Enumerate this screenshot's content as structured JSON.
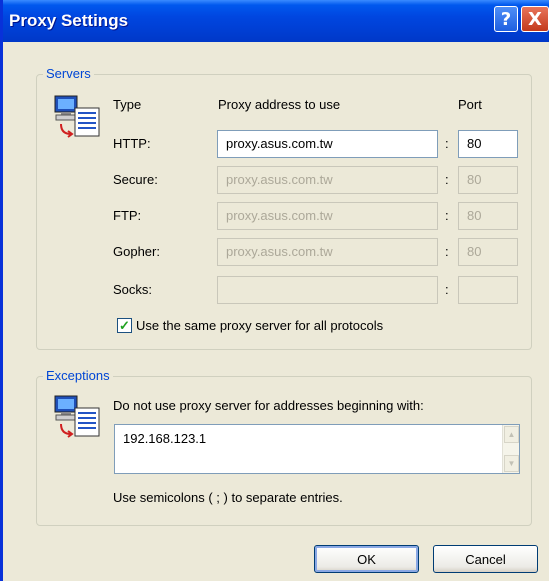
{
  "window": {
    "title": "Proxy Settings"
  },
  "servers": {
    "legend": "Servers",
    "headers": {
      "type": "Type",
      "address": "Proxy address to use",
      "port": "Port"
    },
    "rows": [
      {
        "type": "HTTP:",
        "address": "proxy.asus.com.tw",
        "port": "80",
        "enabled": true
      },
      {
        "type": "Secure:",
        "address": "proxy.asus.com.tw",
        "port": "80",
        "enabled": false
      },
      {
        "type": "FTP:",
        "address": "proxy.asus.com.tw",
        "port": "80",
        "enabled": false
      },
      {
        "type": "Gopher:",
        "address": "proxy.asus.com.tw",
        "port": "80",
        "enabled": false
      },
      {
        "type": "Socks:",
        "address": "",
        "port": "",
        "enabled": false
      }
    ],
    "colon": ":",
    "same_proxy": {
      "label": "Use the same proxy server for all protocols",
      "checked": true
    }
  },
  "exceptions": {
    "legend": "Exceptions",
    "description": "Do not use proxy server for addresses beginning with:",
    "value": "192.168.123.1",
    "hint": "Use semicolons ( ; ) to separate entries."
  },
  "buttons": {
    "ok": "OK",
    "cancel": "Cancel",
    "help": "?",
    "close": "X"
  },
  "icons": {
    "servers": "network-computer-icon",
    "exceptions": "network-computer-icon"
  },
  "colors": {
    "title_bar": "#0046e0",
    "legend": "#0046d5",
    "dialog_bg": "#ece9d8"
  }
}
